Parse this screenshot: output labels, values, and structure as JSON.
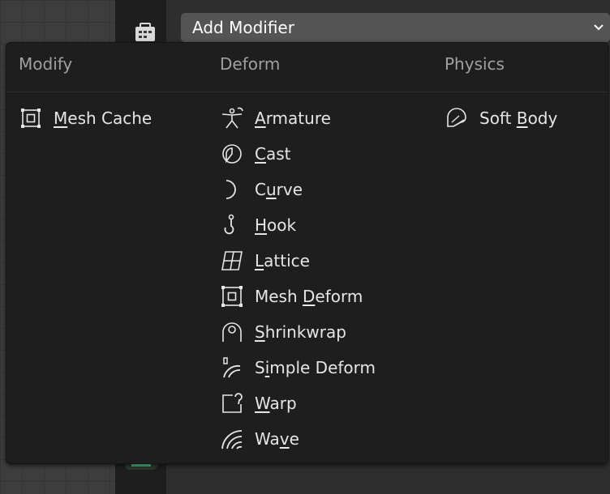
{
  "header": {
    "add_modifier_label": "Add Modifier"
  },
  "menu": {
    "columns": [
      {
        "title": "Modify",
        "items": [
          {
            "label": "Mesh Cache",
            "underline": "M",
            "icon": "mesh-cache-icon"
          }
        ]
      },
      {
        "title": "Deform",
        "items": [
          {
            "label": "Armature",
            "underline": "A",
            "icon": "armature-icon"
          },
          {
            "label": "Cast",
            "underline": "C",
            "icon": "cast-icon"
          },
          {
            "label": "Curve",
            "underline": "u",
            "icon": "curve-icon"
          },
          {
            "label": "Hook",
            "underline": "H",
            "icon": "hook-icon"
          },
          {
            "label": "Lattice",
            "underline": "L",
            "icon": "lattice-icon"
          },
          {
            "label": "Mesh Deform",
            "underline": "D",
            "icon": "mesh-deform-icon"
          },
          {
            "label": "Shrinkwrap",
            "underline": "S",
            "icon": "shrinkwrap-icon"
          },
          {
            "label": "Simple Deform",
            "underline": "i",
            "icon": "simple-deform-icon"
          },
          {
            "label": "Warp",
            "underline": "W",
            "icon": "warp-icon"
          },
          {
            "label": "Wave",
            "underline": "v",
            "icon": "wave-icon"
          }
        ]
      },
      {
        "title": "Physics",
        "items": [
          {
            "label": "Soft Body",
            "underline": "B",
            "icon": "soft-body-icon"
          }
        ]
      }
    ]
  },
  "colors": {
    "menu_bg": "#1e1e1e",
    "header_text": "#a0a0a0",
    "item_text": "#e6e6e6",
    "button_bg": "#545454"
  }
}
